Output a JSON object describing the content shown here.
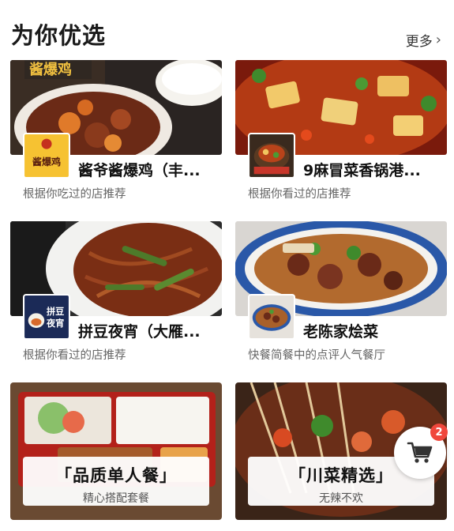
{
  "header": {
    "title": "为你优选",
    "more_label": "更多",
    "more_icon": "chevron-right-icon"
  },
  "cards": [
    {
      "name": "酱爷酱爆鸡（丰...",
      "reason": "根据你吃过的店推荐",
      "logo_text": "酱爆鸡"
    },
    {
      "name": "9麻冒菜香锅港...",
      "reason": "根据你看过的店推荐",
      "logo_text": ""
    },
    {
      "name": "拼豆夜宵（大雁...",
      "reason": "根据你看过的店推荐",
      "logo_text": "拼豆夜宵"
    },
    {
      "name": "老陈家烩菜",
      "reason": "快餐简餐中的点评人气餐厅",
      "logo_text": ""
    }
  ],
  "promos": [
    {
      "title": "「品质单人餐」",
      "subtitle": "精心搭配套餐"
    },
    {
      "title": "「川菜精选」",
      "subtitle": "无辣不欢"
    }
  ],
  "cart": {
    "icon": "cart-icon",
    "badge": "2"
  },
  "colors": {
    "badge": "#f0473c",
    "text": "#111111",
    "muted": "#666666"
  }
}
